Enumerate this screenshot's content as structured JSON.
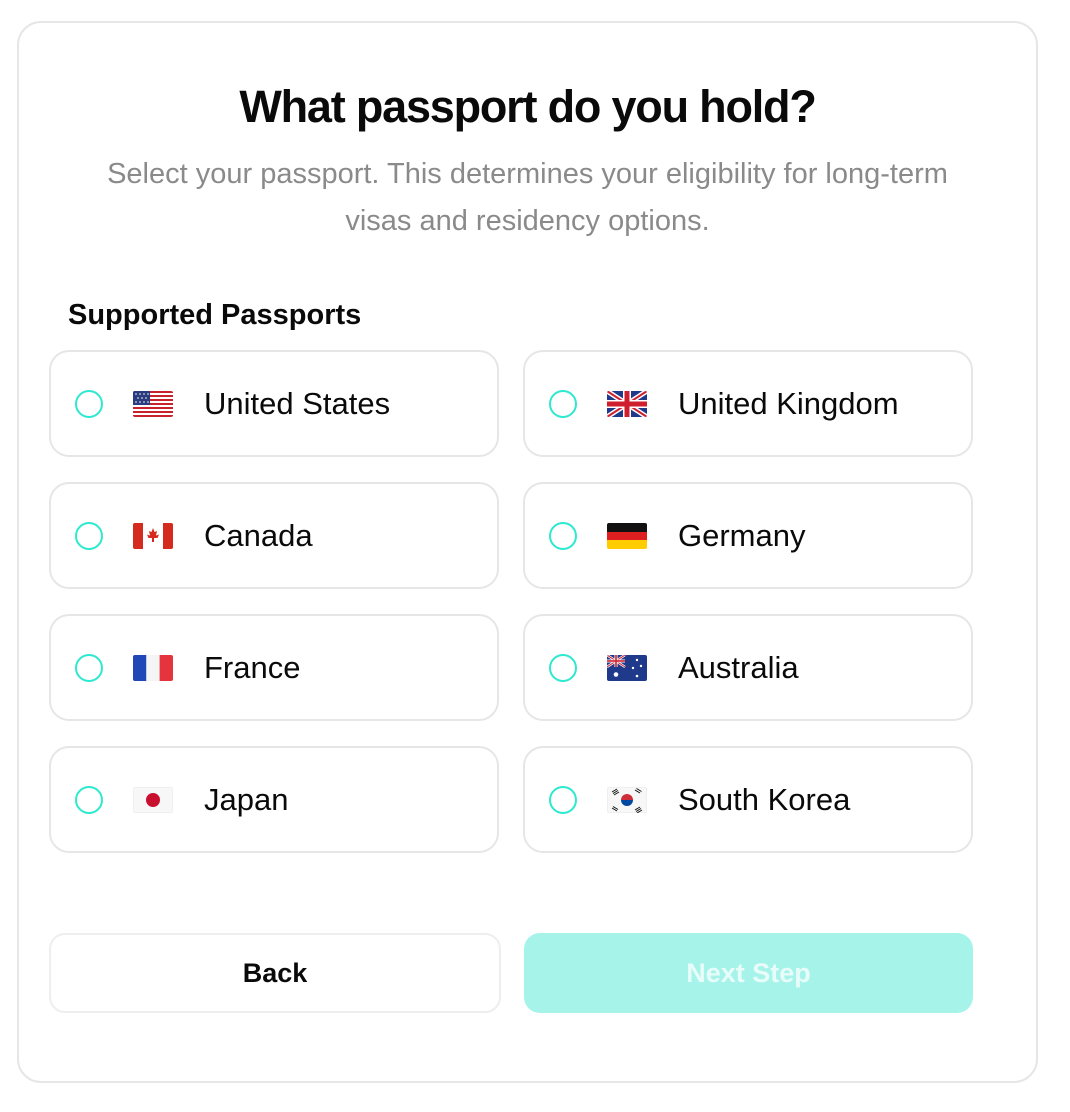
{
  "header": {
    "title": "What passport do you hold?",
    "subtitle": "Select your passport. This determines your eligibility for long-term visas and residency options."
  },
  "section": {
    "label": "Supported Passports"
  },
  "passports": [
    {
      "name": "United States",
      "flag": "us-flag-icon",
      "selected": false
    },
    {
      "name": "United Kingdom",
      "flag": "uk-flag-icon",
      "selected": false
    },
    {
      "name": "Canada",
      "flag": "canada-flag-icon",
      "selected": false
    },
    {
      "name": "Germany",
      "flag": "germany-flag-icon",
      "selected": false
    },
    {
      "name": "France",
      "flag": "france-flag-icon",
      "selected": false
    },
    {
      "name": "Australia",
      "flag": "australia-flag-icon",
      "selected": false
    },
    {
      "name": "Japan",
      "flag": "japan-flag-icon",
      "selected": false
    },
    {
      "name": "South Korea",
      "flag": "south-korea-flag-icon",
      "selected": false
    }
  ],
  "actions": {
    "back_label": "Back",
    "next_label": "Next Step",
    "next_enabled": false
  },
  "colors": {
    "accent": "#2ee8cf",
    "next_button_bg": "#a6f3ea",
    "border": "#e6e6e6",
    "subtitle_text": "#8a8a8a"
  }
}
